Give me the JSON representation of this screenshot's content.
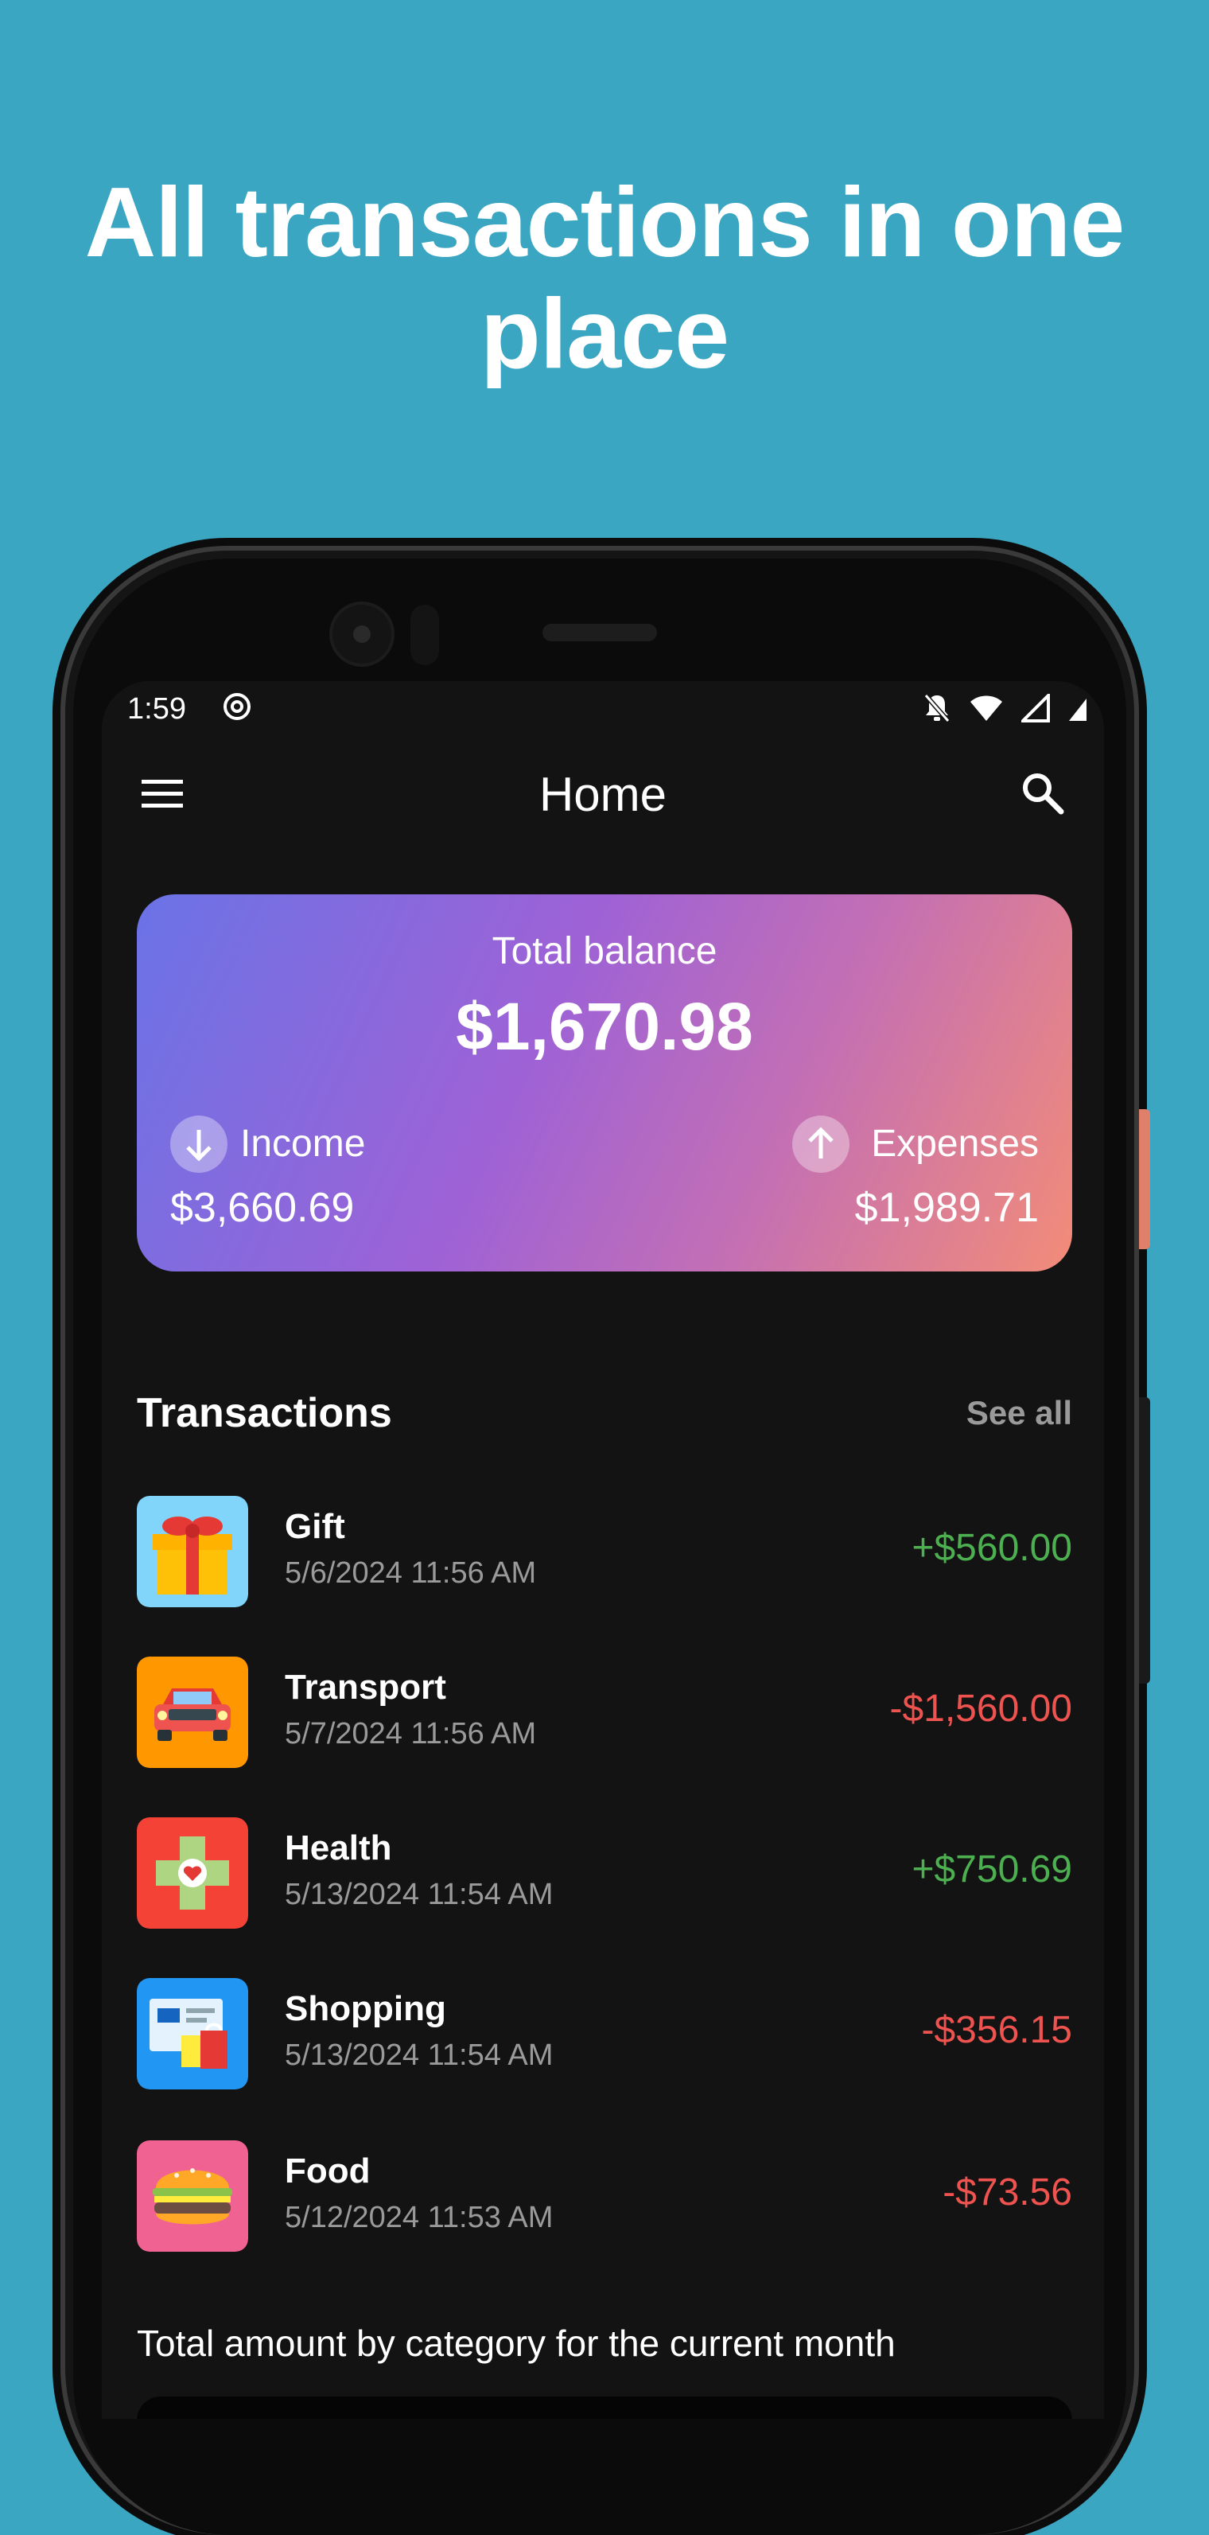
{
  "headline": {
    "line1": "All transactions in one",
    "line2": "place"
  },
  "status_bar": {
    "time": "1:59"
  },
  "app_bar": {
    "title": "Home"
  },
  "balance_card": {
    "label": "Total balance",
    "total": "$1,670.98",
    "income_label": "Income",
    "income_value": "$3,660.69",
    "expenses_label": "Expenses",
    "expenses_value": "$1,989.71"
  },
  "transactions": {
    "title": "Transactions",
    "see_all": "See all",
    "items": [
      {
        "name": "Gift",
        "date": "5/6/2024 11:56 AM",
        "amount": "+$560.00",
        "icon": "gift-icon",
        "color": "#81D4FA"
      },
      {
        "name": "Transport",
        "date": "5/7/2024 11:56 AM",
        "amount": "-$1,560.00",
        "icon": "car-icon",
        "color": "#FF9800"
      },
      {
        "name": "Health",
        "date": "5/13/2024 11:54 AM",
        "amount": "+$750.69",
        "icon": "health-cross-icon",
        "color": "#F44336"
      },
      {
        "name": "Shopping",
        "date": "5/13/2024 11:54 AM",
        "amount": "-$356.15",
        "icon": "shopping-icon",
        "color": "#2196F3"
      },
      {
        "name": "Food",
        "date": "5/12/2024 11:53 AM",
        "amount": "-$73.56",
        "icon": "burger-icon",
        "color": "#F06292"
      }
    ]
  },
  "footer": {
    "text": "Total amount by category for the current month"
  },
  "colors": {
    "background": "#3AA6C2",
    "positive": "#4CAF50",
    "negative": "#EF5350"
  }
}
